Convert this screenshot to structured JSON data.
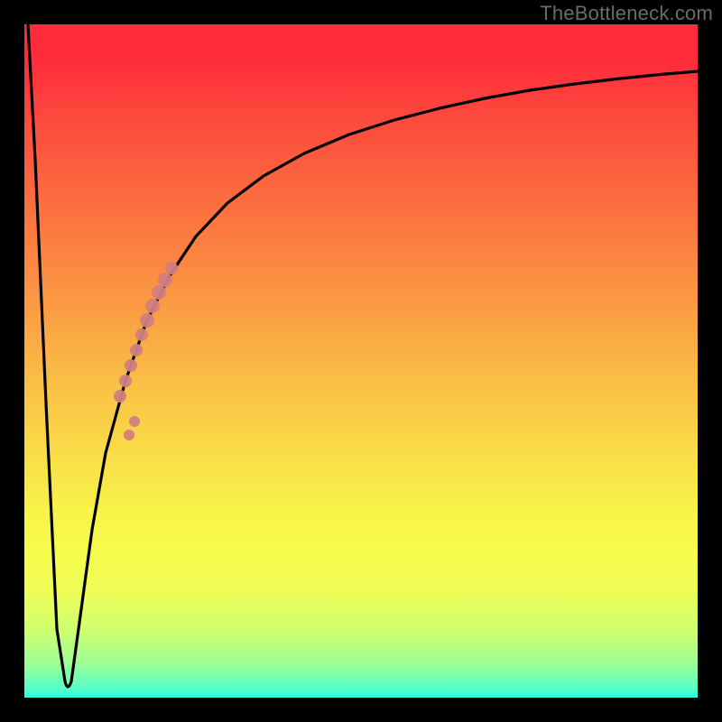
{
  "watermark": "TheBottleneck.com",
  "chart_data": {
    "type": "line",
    "title": "",
    "xlabel": "",
    "ylabel": "",
    "xlim": [
      0,
      100
    ],
    "ylim": [
      0,
      100
    ],
    "series": [
      {
        "name": "bottleneck-curve",
        "x": [
          0,
          1,
          3,
          5,
          6,
          6.5,
          7,
          8,
          10,
          12,
          15,
          18,
          22,
          26,
          30,
          35,
          40,
          45,
          50,
          55,
          60,
          65,
          70,
          75,
          80,
          85,
          90,
          95,
          100
        ],
        "values": [
          100,
          60,
          25,
          5,
          2,
          3,
          6,
          12,
          22,
          32,
          44,
          53,
          61,
          67,
          71,
          76,
          80,
          83,
          85,
          87,
          88.5,
          89.8,
          90.8,
          91.6,
          92.3,
          92.9,
          93.4,
          93.8,
          94.2
        ]
      }
    ],
    "highlight_region": {
      "name": "marker-band",
      "x": [
        14,
        15,
        16,
        17,
        18,
        19,
        20,
        21,
        22
      ],
      "values": [
        41,
        44,
        47,
        50,
        53,
        56,
        58.5,
        60,
        61
      ]
    },
    "gradient_stops": [
      {
        "pos": 0,
        "color": "#fe2b3b"
      },
      {
        "pos": 50,
        "color": "#fab545"
      },
      {
        "pos": 78,
        "color": "#f6fb4c"
      },
      {
        "pos": 100,
        "color": "#27ffe6"
      }
    ]
  }
}
